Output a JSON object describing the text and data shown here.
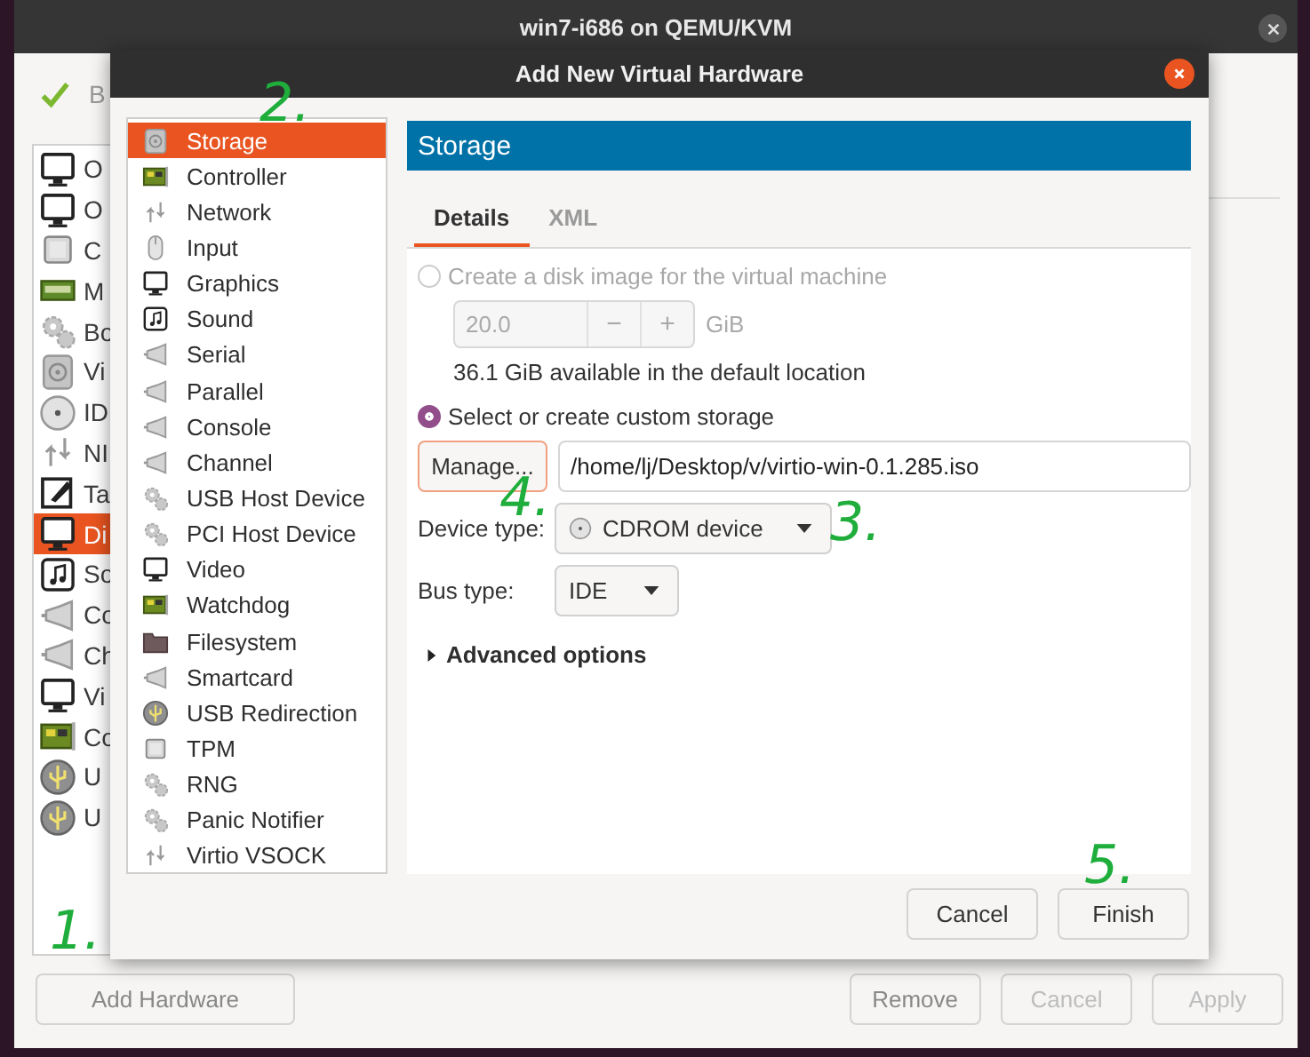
{
  "back_window": {
    "title": "win7-i686 on QEMU/KVM",
    "toolbar_label": "B",
    "sidebar_items": [
      {
        "label": "O",
        "selected": false
      },
      {
        "label": "O",
        "selected": false
      },
      {
        "label": "C",
        "selected": false
      },
      {
        "label": "M",
        "selected": false
      },
      {
        "label": "Bo",
        "selected": false
      },
      {
        "label": "Vi",
        "selected": false
      },
      {
        "label": "ID",
        "selected": false
      },
      {
        "label": "NI",
        "selected": false
      },
      {
        "label": "Ta",
        "selected": false
      },
      {
        "label": "Di",
        "selected": true
      },
      {
        "label": "So",
        "selected": false
      },
      {
        "label": "Co",
        "selected": false
      },
      {
        "label": "Ch",
        "selected": false
      },
      {
        "label": "Vi",
        "selected": false
      },
      {
        "label": "Co",
        "selected": false
      },
      {
        "label": "U",
        "selected": false
      },
      {
        "label": "U",
        "selected": false
      }
    ],
    "buttons": [
      {
        "label": "Add Hardware",
        "disabled": false
      },
      {
        "label": "Remove",
        "disabled": false
      },
      {
        "label": "Cancel",
        "disabled": true
      },
      {
        "label": "Apply",
        "disabled": true
      }
    ]
  },
  "dialog": {
    "title": "Add New Virtual Hardware",
    "device_list": [
      {
        "label": "Storage",
        "selected": true
      },
      {
        "label": "Controller",
        "selected": false
      },
      {
        "label": "Network",
        "selected": false
      },
      {
        "label": "Input",
        "selected": false
      },
      {
        "label": "Graphics",
        "selected": false
      },
      {
        "label": "Sound",
        "selected": false
      },
      {
        "label": "Serial",
        "selected": false
      },
      {
        "label": "Parallel",
        "selected": false
      },
      {
        "label": "Console",
        "selected": false
      },
      {
        "label": "Channel",
        "selected": false
      },
      {
        "label": "USB Host Device",
        "selected": false
      },
      {
        "label": "PCI Host Device",
        "selected": false
      },
      {
        "label": "Video",
        "selected": false
      },
      {
        "label": "Watchdog",
        "selected": false
      },
      {
        "label": "Filesystem",
        "selected": false
      },
      {
        "label": "Smartcard",
        "selected": false
      },
      {
        "label": "USB Redirection",
        "selected": false
      },
      {
        "label": "TPM",
        "selected": false
      },
      {
        "label": "RNG",
        "selected": false
      },
      {
        "label": "Panic Notifier",
        "selected": false
      },
      {
        "label": "Virtio VSOCK",
        "selected": false
      }
    ],
    "panel_title": "Storage",
    "tabs": [
      {
        "label": "Details",
        "selected": true
      },
      {
        "label": "XML",
        "selected": false
      }
    ],
    "storage_options": [
      {
        "label": "Create a disk image for the virtual machine",
        "selected": false,
        "disabled": true
      },
      {
        "label": "Select or create custom storage",
        "selected": true,
        "disabled": false
      }
    ],
    "disk_size": {
      "value": "20.0",
      "unit": "GiB",
      "decrement": "−",
      "increment": "+",
      "disabled": true
    },
    "available_note": "36.1 GiB available in the default location",
    "manage_button": "Manage...",
    "path_field": {
      "value": "/home/lj/Desktop/v/virtio-win-0.1.285.iso"
    },
    "device_type": {
      "label": "Device type:",
      "value": "CDROM device"
    },
    "bus_type": {
      "label": "Bus type:",
      "value": "IDE"
    },
    "advanced_options": {
      "label": "Advanced options",
      "expanded": false
    },
    "buttons": [
      {
        "label": "Cancel"
      },
      {
        "label": "Finish"
      }
    ]
  },
  "annotations": [
    {
      "label": "2."
    },
    {
      "label": "4."
    },
    {
      "label": "3."
    },
    {
      "label": "5."
    },
    {
      "label": "1."
    }
  ]
}
